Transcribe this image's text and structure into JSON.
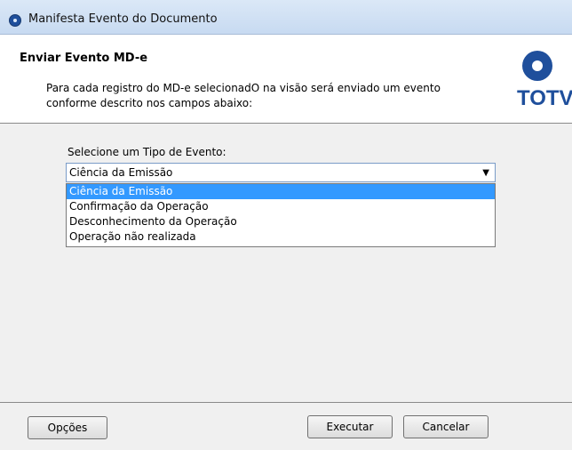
{
  "window": {
    "title": "Manifesta Evento do Documento"
  },
  "header": {
    "title": "Enviar Evento MD-e",
    "description": "Para cada registro do MD-e selecionadO na visão será enviado um evento conforme descrito nos campos abaixo:",
    "logo_text": "TOTVS"
  },
  "form": {
    "event_type_label": "Selecione um Tipo de Evento:",
    "event_type_value": "Ciência da Emissão",
    "options": [
      "Ciência da Emissão",
      "Confirmação da Operação",
      "Desconhecimento da Operação",
      "Operação não realizada"
    ]
  },
  "footer": {
    "options_label": "Opções",
    "execute_label": "Executar",
    "cancel_label": "Cancelar"
  }
}
